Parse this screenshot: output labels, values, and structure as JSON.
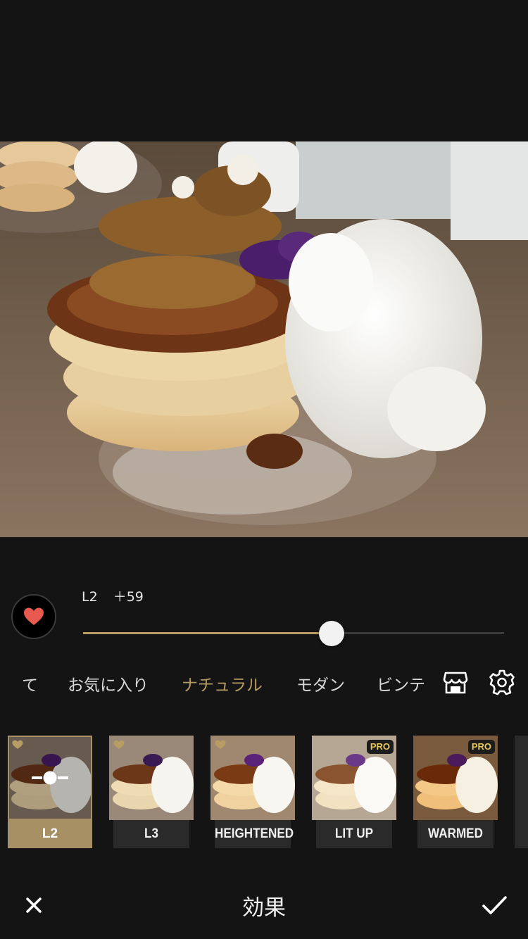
{
  "adjust": {
    "filter_name": "L2",
    "value_text": "＋59",
    "slider_fraction": 0.59
  },
  "categories": [
    {
      "label": "て",
      "active": false
    },
    {
      "label": "お気に入り",
      "active": false
    },
    {
      "label": "ナチュラル",
      "active": true
    },
    {
      "label": "モダン",
      "active": false
    },
    {
      "label": "ビンテ",
      "active": false
    }
  ],
  "filters": [
    {
      "label": "L2",
      "selected": true,
      "favorite": true,
      "pro": false
    },
    {
      "label": "L3",
      "selected": false,
      "favorite": true,
      "pro": false
    },
    {
      "label": "HEIGHTENED",
      "selected": false,
      "favorite": true,
      "pro": false
    },
    {
      "label": "LIT UP",
      "selected": false,
      "favorite": false,
      "pro": true,
      "pro_label": "PRO"
    },
    {
      "label": "WARMED",
      "selected": false,
      "favorite": false,
      "pro": true,
      "pro_label": "PRO"
    }
  ],
  "bottom_bar": {
    "title": "効果"
  },
  "colors": {
    "accent": "#b79c63",
    "background": "#141414",
    "heart": "#e85a50"
  }
}
